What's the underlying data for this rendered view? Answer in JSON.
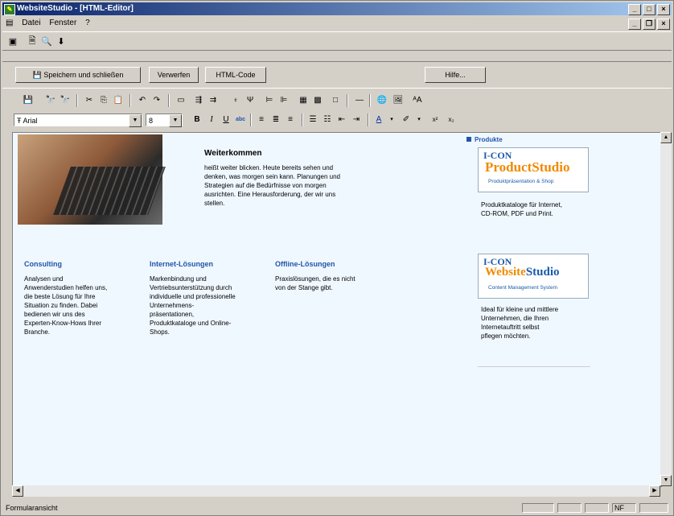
{
  "window": {
    "title": "WebsiteStudio - [HTML-Editor]"
  },
  "menu": {
    "items": [
      "Datei",
      "Fenster",
      "?"
    ]
  },
  "buttons": {
    "save_close": "Speichern und schließen",
    "discard": "Verwerfen",
    "html_code": "HTML-Code",
    "help": "Hilfe..."
  },
  "format": {
    "font": "Arial",
    "size": "8"
  },
  "content": {
    "intro_title": "Weiterkommen",
    "intro_lines": [
      "heißt weiter blicken. Heute bereits sehen und",
      "denken, was morgen sein kann. Planungen und",
      "Strategien auf die Bedürfnisse von morgen",
      "ausrichten. Eine Herausforderung, der wir uns",
      "stellen."
    ],
    "col1": {
      "title": "Consulting",
      "lines": [
        "Analysen und",
        "Anwenderstudien helfen uns,",
        "die beste Lösung für Ihre",
        "Situation zu finden. Dabei",
        "bedienen wir uns des",
        "Experten-Know-Hows Ihrer",
        "Branche."
      ]
    },
    "col2": {
      "title": "Internet-Lösungen",
      "lines": [
        "Markenbindung und",
        "Vertriebsunterstützung durch",
        "individuelle und professionelle",
        "Unternehmens-",
        "präsentationen,",
        "Produktkataloge und Online-",
        "Shops."
      ]
    },
    "col3": {
      "title": "Offline-Lösungen",
      "lines": [
        "Praxislösungen, die es nicht",
        "von der Stange gibt."
      ]
    },
    "side": {
      "heading": "Produkte",
      "logo1": {
        "top": "I-CON",
        "main": "ProductStudio",
        "tag": "Produktpräsentation & Shop"
      },
      "desc1": [
        "Produktkataloge für Internet,",
        "CD-ROM, PDF und Print."
      ],
      "logo2": {
        "top": "I-CON",
        "main": "WebsiteStudio",
        "tag": "Content Management System"
      },
      "desc2": [
        "Ideal für kleine und mittlere",
        "Unternehmen, die Ihren",
        "Internetauftritt selbst",
        "pflegen möchten."
      ]
    }
  },
  "status": {
    "left": "Formularansicht",
    "nf": "NF"
  }
}
